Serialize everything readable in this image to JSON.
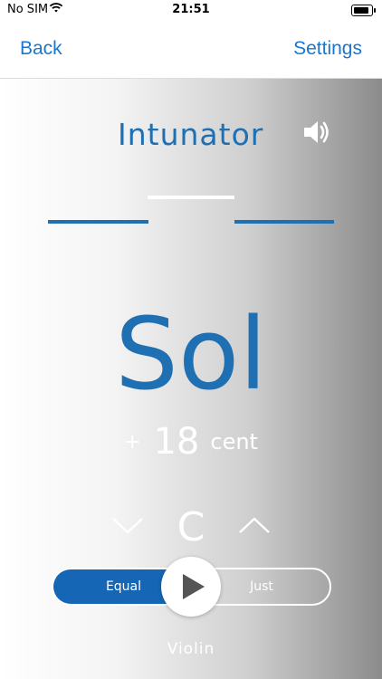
{
  "status_bar": {
    "carrier": "No SIM",
    "time": "21:51"
  },
  "nav": {
    "back_label": "Back",
    "settings_label": "Settings"
  },
  "logo": {
    "text": "Intunator"
  },
  "tuner": {
    "note": "Sol",
    "cent_sign": "+",
    "cent_value": "18",
    "cent_unit": "cent"
  },
  "key": {
    "label": "C"
  },
  "temperament": {
    "equal_label": "Equal",
    "just_label": "Just",
    "selected": "Equal"
  },
  "instrument": {
    "label": "Violin"
  },
  "icons": {
    "speaker": "speaker-icon",
    "play": "play-icon",
    "prev": "chevron-down-icon",
    "next": "chevron-up-icon"
  },
  "colors": {
    "accent": "#1f6fb3",
    "nav_link": "#1a76cf",
    "segment_selected": "#1566b4"
  }
}
